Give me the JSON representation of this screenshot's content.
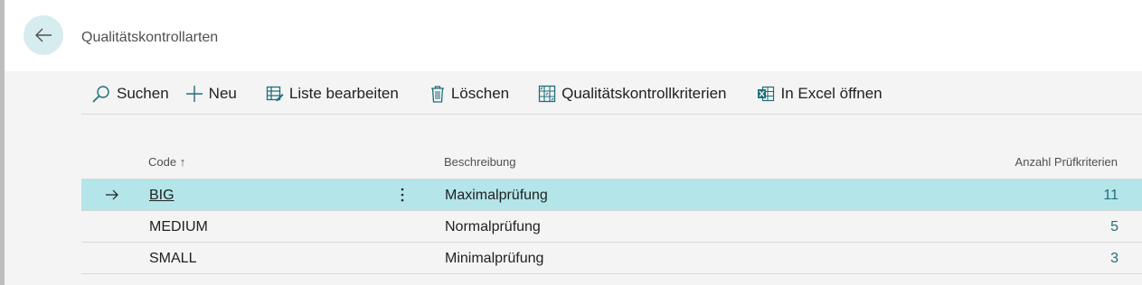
{
  "header": {
    "title": "Qualitätskontrollarten",
    "back_icon": "arrow-left-icon"
  },
  "actions": [
    {
      "label": "Suchen",
      "icon": "search-icon"
    },
    {
      "label": "Neu",
      "icon": "plus-icon"
    },
    {
      "label": "Liste bearbeiten",
      "icon": "edit-list-icon"
    },
    {
      "label": "Löschen",
      "icon": "trash-icon"
    },
    {
      "label": "Qualitätskontrollkriterien",
      "icon": "criteria-icon"
    },
    {
      "label": "In Excel öffnen",
      "icon": "excel-icon"
    }
  ],
  "table": {
    "columns": {
      "code": "Code",
      "sort_indicator": "↑",
      "description": "Beschreibung",
      "count": "Anzahl Prüfkriterien"
    },
    "rows": [
      {
        "code": "BIG",
        "description": "Maximalprüfung",
        "count": "11",
        "selected": true
      },
      {
        "code": "MEDIUM",
        "description": "Normalprüfung",
        "count": "5",
        "selected": false
      },
      {
        "code": "SMALL",
        "description": "Minimalprüfung",
        "count": "3",
        "selected": false
      }
    ]
  },
  "colors": {
    "accent": "#1f6f7a",
    "selected_row": "#b3e5e9",
    "back_button": "#d6ecee"
  }
}
